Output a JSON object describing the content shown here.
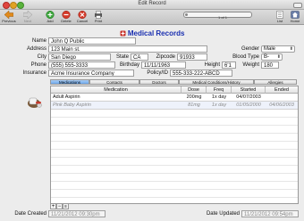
{
  "window": {
    "title": "Edit Record"
  },
  "toolbar": {
    "previous": "Previous",
    "next": "Next",
    "add": "Add",
    "delete": "Delete",
    "cancel": "Cancel",
    "print": "Print",
    "list": "List",
    "home": "Home",
    "record_counter": "1 of 1"
  },
  "form": {
    "heading": "Medical Records",
    "name_label": "Name",
    "name_value": "John Q Public",
    "gender_label": "Gender",
    "gender_value": "Male",
    "address_label": "Address",
    "address_value": "123 Main st.",
    "city_label": "City",
    "city_value": "San Diego",
    "state_label": "State",
    "state_value": "CA",
    "zip_label": "Zipcode",
    "zip_value": "91933",
    "blood_label": "Blood Type",
    "blood_value": "B-",
    "phone_label": "Phone",
    "phone_value": "(555) 555-3333",
    "birthday_label": "Birthday",
    "birthday_value": "11/11/1963",
    "height_label": "Height",
    "height_value": "6'1",
    "weight_label": "Weight",
    "weight_value": "180",
    "insurance_label": "Insurance",
    "insurance_value": "Acme Insurance Company",
    "policy_label": "Policy/ID",
    "policy_value": "555-333-222-ABCD"
  },
  "tabs": [
    {
      "label": "Medications"
    },
    {
      "label": "Contacts"
    },
    {
      "label": "Doctors"
    },
    {
      "label": "Medical Conditions/History"
    },
    {
      "label": "Allergies"
    }
  ],
  "table": {
    "columns": [
      "Medication",
      "Dose",
      "Freq",
      "Started",
      "Ended"
    ],
    "rows": [
      {
        "medication": "Adult Aspirin",
        "dose": "200mg",
        "freq": "1x day",
        "started": "04/07/2003",
        "ended": ""
      },
      {
        "medication": "Pink Baby Aspirin",
        "dose": "81mg",
        "freq": "1x day",
        "started": "01/05/2000",
        "ended": "04/06/2003"
      }
    ]
  },
  "footer": {
    "created_label": "Date Created",
    "created_value": "11/21/2012 09:30pm",
    "updated_label": "Date Updated",
    "updated_value": "11/21/2012 09:54pm"
  },
  "colors": {
    "heading": "#1a2fb0",
    "active_tab": "#6ca7ea"
  }
}
